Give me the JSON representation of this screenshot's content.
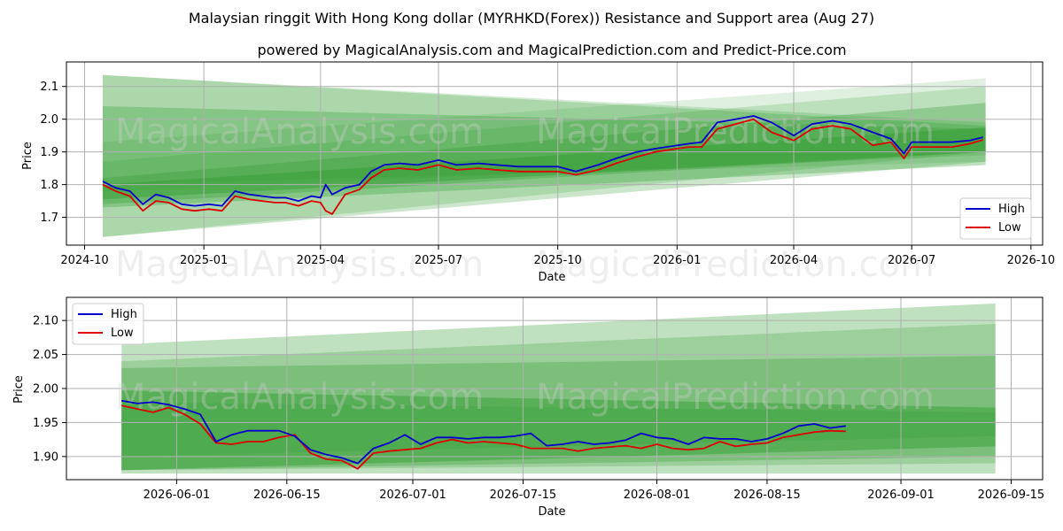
{
  "titles": {
    "line1": "Malaysian ringgit With Hong Kong dollar (MYRHKD(Forex)) Resistance and Support area (Aug 27)",
    "line2": "powered by MagicalAnalysis.com and MagicalPrediction.com and Predict-Price.com"
  },
  "watermarks": {
    "top": [
      "MagicalAnalysis.com",
      "MagicalPrediction.com",
      "MagicalAnalysis.com",
      "MagicalPrediction.com"
    ],
    "bottom": [
      "MagicalAnalysis.com",
      "MagicalPrediction.com"
    ]
  },
  "colors": {
    "high": "#0000cc",
    "low": "#dd0000",
    "band": "#2e9b2e",
    "grid": "#b0b0b0"
  },
  "chart_data": [
    {
      "type": "line",
      "id": "overview",
      "xlabel": "Date",
      "ylabel": "Price",
      "xlim": [
        "2024-09-17",
        "2026-10-10"
      ],
      "ylim": [
        1.615,
        2.175
      ],
      "xticks": [
        "2024-10-01",
        "2025-01-01",
        "2025-04-01",
        "2025-07-01",
        "2025-10-01",
        "2026-01-01",
        "2026-04-01",
        "2026-07-01",
        "2026-10-01"
      ],
      "xtick_labels": [
        "2024-10",
        "2025-01",
        "2025-04",
        "2025-07",
        "2025-10",
        "2026-01",
        "2026-04",
        "2026-07",
        "2026-10"
      ],
      "yticks": [
        1.7,
        1.8,
        1.9,
        2.0,
        2.1
      ],
      "ytick_labels": [
        "1.7",
        "1.8",
        "1.9",
        "2.0",
        "2.1"
      ],
      "grid": true,
      "legend": "lower-right",
      "bands": [
        {
          "x": [
            "2024-10-15",
            "2026-08-27"
          ],
          "upper": [
            2.135,
            1.99
          ],
          "lower": [
            1.64,
            1.9
          ],
          "alpha": 0.2
        },
        {
          "x": [
            "2024-10-15",
            "2026-08-27"
          ],
          "upper": [
            2.135,
            1.98
          ],
          "lower": [
            1.64,
            1.87
          ],
          "alpha": 0.25
        },
        {
          "x": [
            "2024-10-15",
            "2026-08-27"
          ],
          "upper": [
            2.04,
            1.97
          ],
          "lower": [
            1.73,
            1.86
          ],
          "alpha": 0.3
        },
        {
          "x": [
            "2024-10-15",
            "2026-08-27"
          ],
          "upper": [
            1.93,
            2.125
          ],
          "lower": [
            1.8,
            1.87
          ],
          "alpha": 0.15
        },
        {
          "x": [
            "2024-10-15",
            "2026-08-27"
          ],
          "upper": [
            1.87,
            2.1
          ],
          "lower": [
            1.78,
            1.89
          ],
          "alpha": 0.2
        },
        {
          "x": [
            "2024-10-15",
            "2026-08-27"
          ],
          "upper": [
            1.82,
            2.05
          ],
          "lower": [
            1.74,
            1.9
          ],
          "alpha": 0.3
        },
        {
          "x": [
            "2024-10-15",
            "2026-08-27"
          ],
          "upper": [
            1.8,
            1.975
          ],
          "lower": [
            1.755,
            1.9
          ],
          "alpha": 0.4
        }
      ],
      "series": [
        {
          "name": "High",
          "x": [
            "2024-10-15",
            "2024-10-25",
            "2024-11-05",
            "2024-11-15",
            "2024-11-25",
            "2024-12-05",
            "2024-12-15",
            "2024-12-25",
            "2025-01-05",
            "2025-01-15",
            "2025-01-25",
            "2025-02-05",
            "2025-02-15",
            "2025-02-25",
            "2025-03-05",
            "2025-03-15",
            "2025-03-25",
            "2025-04-01",
            "2025-04-05",
            "2025-04-10",
            "2025-04-20",
            "2025-05-01",
            "2025-05-10",
            "2025-05-20",
            "2025-06-01",
            "2025-06-15",
            "2025-07-01",
            "2025-07-15",
            "2025-08-01",
            "2025-08-15",
            "2025-09-01",
            "2025-09-15",
            "2025-10-01",
            "2025-10-15",
            "2025-11-01",
            "2025-11-15",
            "2025-12-01",
            "2025-12-15",
            "2026-01-01",
            "2026-01-10",
            "2026-01-20",
            "2026-02-01",
            "2026-02-15",
            "2026-03-01",
            "2026-03-15",
            "2026-04-01",
            "2026-04-15",
            "2026-05-01",
            "2026-05-15",
            "2026-06-01",
            "2026-06-15",
            "2026-06-25",
            "2026-07-01",
            "2026-07-15",
            "2026-08-01",
            "2026-08-15",
            "2026-08-25"
          ],
          "y": [
            1.81,
            1.79,
            1.78,
            1.74,
            1.77,
            1.76,
            1.74,
            1.735,
            1.74,
            1.735,
            1.78,
            1.77,
            1.765,
            1.76,
            1.76,
            1.75,
            1.765,
            1.76,
            1.8,
            1.77,
            1.79,
            1.8,
            1.84,
            1.86,
            1.865,
            1.86,
            1.875,
            1.86,
            1.865,
            1.86,
            1.855,
            1.855,
            1.855,
            1.84,
            1.86,
            1.88,
            1.9,
            1.91,
            1.92,
            1.925,
            1.93,
            1.99,
            2.0,
            2.01,
            1.99,
            1.95,
            1.985,
            1.995,
            1.985,
            1.96,
            1.94,
            1.895,
            1.93,
            1.93,
            1.93,
            1.935,
            1.945
          ]
        },
        {
          "name": "Low",
          "x": [
            "2024-10-15",
            "2024-10-25",
            "2024-11-05",
            "2024-11-15",
            "2024-11-25",
            "2024-12-05",
            "2024-12-15",
            "2024-12-25",
            "2025-01-05",
            "2025-01-15",
            "2025-01-25",
            "2025-02-05",
            "2025-02-15",
            "2025-02-25",
            "2025-03-05",
            "2025-03-15",
            "2025-03-25",
            "2025-04-01",
            "2025-04-05",
            "2025-04-10",
            "2025-04-20",
            "2025-05-01",
            "2025-05-10",
            "2025-05-20",
            "2025-06-01",
            "2025-06-15",
            "2025-07-01",
            "2025-07-15",
            "2025-08-01",
            "2025-08-15",
            "2025-09-01",
            "2025-09-15",
            "2025-10-01",
            "2025-10-15",
            "2025-11-01",
            "2025-11-15",
            "2025-12-01",
            "2025-12-15",
            "2026-01-01",
            "2026-01-10",
            "2026-01-20",
            "2026-02-01",
            "2026-02-15",
            "2026-03-01",
            "2026-03-15",
            "2026-04-01",
            "2026-04-15",
            "2026-05-01",
            "2026-05-15",
            "2026-06-01",
            "2026-06-15",
            "2026-06-25",
            "2026-07-01",
            "2026-07-15",
            "2026-08-01",
            "2026-08-15",
            "2026-08-25"
          ],
          "y": [
            1.8,
            1.78,
            1.765,
            1.72,
            1.75,
            1.745,
            1.725,
            1.72,
            1.725,
            1.72,
            1.765,
            1.755,
            1.75,
            1.745,
            1.745,
            1.735,
            1.75,
            1.745,
            1.72,
            1.71,
            1.77,
            1.785,
            1.82,
            1.845,
            1.85,
            1.845,
            1.86,
            1.845,
            1.85,
            1.845,
            1.84,
            1.84,
            1.84,
            1.83,
            1.845,
            1.865,
            1.885,
            1.9,
            1.91,
            1.915,
            1.915,
            1.97,
            1.985,
            2.0,
            1.96,
            1.935,
            1.97,
            1.98,
            1.97,
            1.92,
            1.93,
            1.88,
            1.915,
            1.915,
            1.915,
            1.925,
            1.937
          ]
        }
      ]
    },
    {
      "type": "line",
      "id": "zoom",
      "xlabel": "Date",
      "ylabel": "Price",
      "xlim": [
        "2026-05-18",
        "2026-09-19"
      ],
      "ylim": [
        1.866,
        2.134
      ],
      "xticks": [
        "2026-06-01",
        "2026-06-15",
        "2026-07-01",
        "2026-07-15",
        "2026-08-01",
        "2026-08-15",
        "2026-09-01",
        "2026-09-15"
      ],
      "xtick_labels": [
        "2026-06-01",
        "2026-06-15",
        "2026-07-01",
        "2026-07-15",
        "2026-08-01",
        "2026-08-15",
        "2026-09-01",
        "2026-09-15"
      ],
      "yticks": [
        1.9,
        1.95,
        2.0,
        2.05,
        2.1
      ],
      "ytick_labels": [
        "1.90",
        "1.95",
        "2.00",
        "2.05",
        "2.10"
      ],
      "grid": true,
      "legend": "upper-left",
      "bands": [
        {
          "x": [
            "2026-05-25",
            "2026-09-13"
          ],
          "upper": [
            2.065,
            2.125
          ],
          "lower": [
            1.875,
            1.875
          ],
          "alpha": 0.3
        },
        {
          "x": [
            "2026-05-25",
            "2026-09-13"
          ],
          "upper": [
            2.04,
            2.095
          ],
          "lower": [
            1.88,
            1.89
          ],
          "alpha": 0.25
        },
        {
          "x": [
            "2026-05-25",
            "2026-09-13"
          ],
          "upper": [
            2.03,
            2.048
          ],
          "lower": [
            1.88,
            1.9
          ],
          "alpha": 0.3
        },
        {
          "x": [
            "2026-05-25",
            "2026-09-13"
          ],
          "upper": [
            1.997,
            1.972
          ],
          "lower": [
            1.88,
            1.915
          ],
          "alpha": 0.45
        },
        {
          "x": [
            "2026-05-25",
            "2026-09-13"
          ],
          "upper": [
            1.98,
            1.965
          ],
          "lower": [
            1.9,
            1.93
          ],
          "alpha": 0.2
        }
      ],
      "series": [
        {
          "name": "High",
          "x": [
            "2026-05-25",
            "2026-05-27",
            "2026-05-29",
            "2026-05-31",
            "2026-06-02",
            "2026-06-04",
            "2026-06-06",
            "2026-06-08",
            "2026-06-10",
            "2026-06-12",
            "2026-06-14",
            "2026-06-16",
            "2026-06-18",
            "2026-06-20",
            "2026-06-22",
            "2026-06-24",
            "2026-06-26",
            "2026-06-28",
            "2026-06-30",
            "2026-07-02",
            "2026-07-04",
            "2026-07-06",
            "2026-07-08",
            "2026-07-10",
            "2026-07-12",
            "2026-07-14",
            "2026-07-16",
            "2026-07-18",
            "2026-07-20",
            "2026-07-22",
            "2026-07-24",
            "2026-07-26",
            "2026-07-28",
            "2026-07-30",
            "2026-08-01",
            "2026-08-03",
            "2026-08-05",
            "2026-08-07",
            "2026-08-09",
            "2026-08-11",
            "2026-08-13",
            "2026-08-15",
            "2026-08-17",
            "2026-08-19",
            "2026-08-21",
            "2026-08-23",
            "2026-08-25"
          ],
          "y": [
            1.982,
            1.978,
            1.98,
            1.976,
            1.97,
            1.962,
            1.922,
            1.932,
            1.938,
            1.938,
            1.938,
            1.93,
            1.91,
            1.903,
            1.898,
            1.89,
            1.912,
            1.92,
            1.932,
            1.918,
            1.928,
            1.928,
            1.926,
            1.928,
            1.928,
            1.93,
            1.934,
            1.916,
            1.918,
            1.922,
            1.918,
            1.92,
            1.924,
            1.934,
            1.928,
            1.926,
            1.918,
            1.928,
            1.926,
            1.926,
            1.922,
            1.926,
            1.934,
            1.945,
            1.948,
            1.942,
            1.945
          ]
        },
        {
          "name": "Low",
          "x": [
            "2026-05-25",
            "2026-05-27",
            "2026-05-29",
            "2026-05-31",
            "2026-06-02",
            "2026-06-04",
            "2026-06-06",
            "2026-06-08",
            "2026-06-10",
            "2026-06-12",
            "2026-06-14",
            "2026-06-16",
            "2026-06-18",
            "2026-06-20",
            "2026-06-22",
            "2026-06-24",
            "2026-06-26",
            "2026-06-28",
            "2026-06-30",
            "2026-07-02",
            "2026-07-04",
            "2026-07-06",
            "2026-07-08",
            "2026-07-10",
            "2026-07-12",
            "2026-07-14",
            "2026-07-16",
            "2026-07-18",
            "2026-07-20",
            "2026-07-22",
            "2026-07-24",
            "2026-07-26",
            "2026-07-28",
            "2026-07-30",
            "2026-08-01",
            "2026-08-03",
            "2026-08-05",
            "2026-08-07",
            "2026-08-09",
            "2026-08-11",
            "2026-08-13",
            "2026-08-15",
            "2026-08-17",
            "2026-08-19",
            "2026-08-21",
            "2026-08-23",
            "2026-08-25"
          ],
          "y": [
            1.975,
            1.97,
            1.965,
            1.972,
            1.962,
            1.948,
            1.92,
            1.918,
            1.922,
            1.922,
            1.928,
            1.932,
            1.905,
            1.896,
            1.894,
            1.882,
            1.905,
            1.908,
            1.91,
            1.912,
            1.92,
            1.925,
            1.92,
            1.922,
            1.92,
            1.918,
            1.912,
            1.912,
            1.912,
            1.908,
            1.912,
            1.914,
            1.916,
            1.912,
            1.918,
            1.912,
            1.91,
            1.912,
            1.922,
            1.915,
            1.918,
            1.92,
            1.928,
            1.932,
            1.936,
            1.938,
            1.937
          ]
        }
      ]
    }
  ]
}
